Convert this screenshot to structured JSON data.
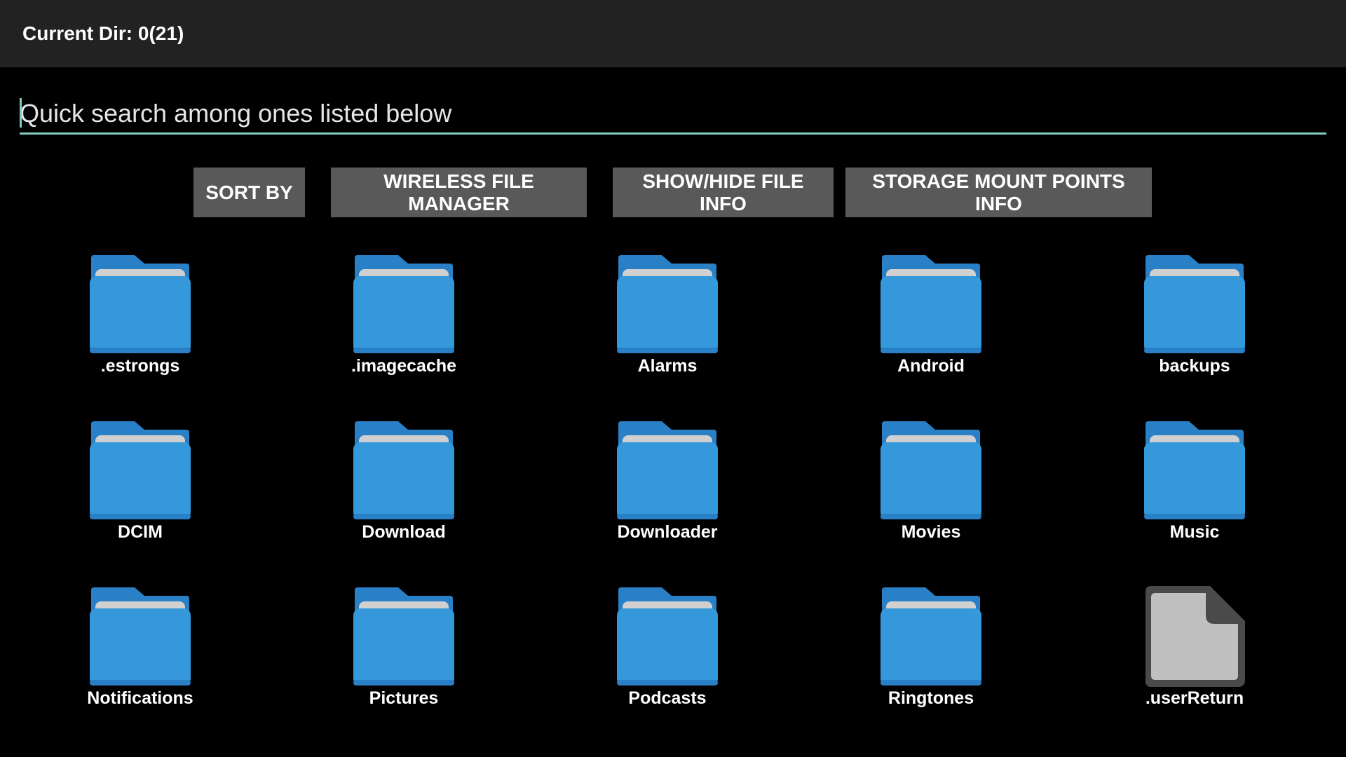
{
  "header": {
    "title": "Current Dir: 0(21)"
  },
  "search": {
    "placeholder": "Quick search among ones listed below",
    "value": ""
  },
  "toolbar": {
    "sort_label": "SORT BY",
    "wireless_label": "WIRELESS FILE MANAGER",
    "fileinfo_label": "SHOW/HIDE FILE INFO",
    "mount_label": "STORAGE MOUNT POINTS INFO"
  },
  "colors": {
    "topbar": "#222222",
    "background": "#000000",
    "accent": "#80cbc4",
    "button": "#595959",
    "folder": "#3498db",
    "folder_tab": "#2a80c6",
    "folder_paper": "#d0d0d0",
    "file": "#c0c0c0"
  },
  "files": [
    {
      "name": ".estrongs",
      "icon": "folder-icon"
    },
    {
      "name": ".imagecache",
      "icon": "folder-icon"
    },
    {
      "name": "Alarms",
      "icon": "folder-icon"
    },
    {
      "name": "Android",
      "icon": "folder-icon"
    },
    {
      "name": "backups",
      "icon": "folder-icon"
    },
    {
      "name": "DCIM",
      "icon": "folder-icon"
    },
    {
      "name": "Download",
      "icon": "folder-icon"
    },
    {
      "name": "Downloader",
      "icon": "folder-icon"
    },
    {
      "name": "Movies",
      "icon": "folder-icon"
    },
    {
      "name": "Music",
      "icon": "folder-icon"
    },
    {
      "name": "Notifications",
      "icon": "folder-icon"
    },
    {
      "name": "Pictures",
      "icon": "folder-icon"
    },
    {
      "name": "Podcasts",
      "icon": "folder-icon"
    },
    {
      "name": "Ringtones",
      "icon": "folder-icon"
    },
    {
      "name": ".userReturn",
      "icon": "file-icon"
    }
  ]
}
